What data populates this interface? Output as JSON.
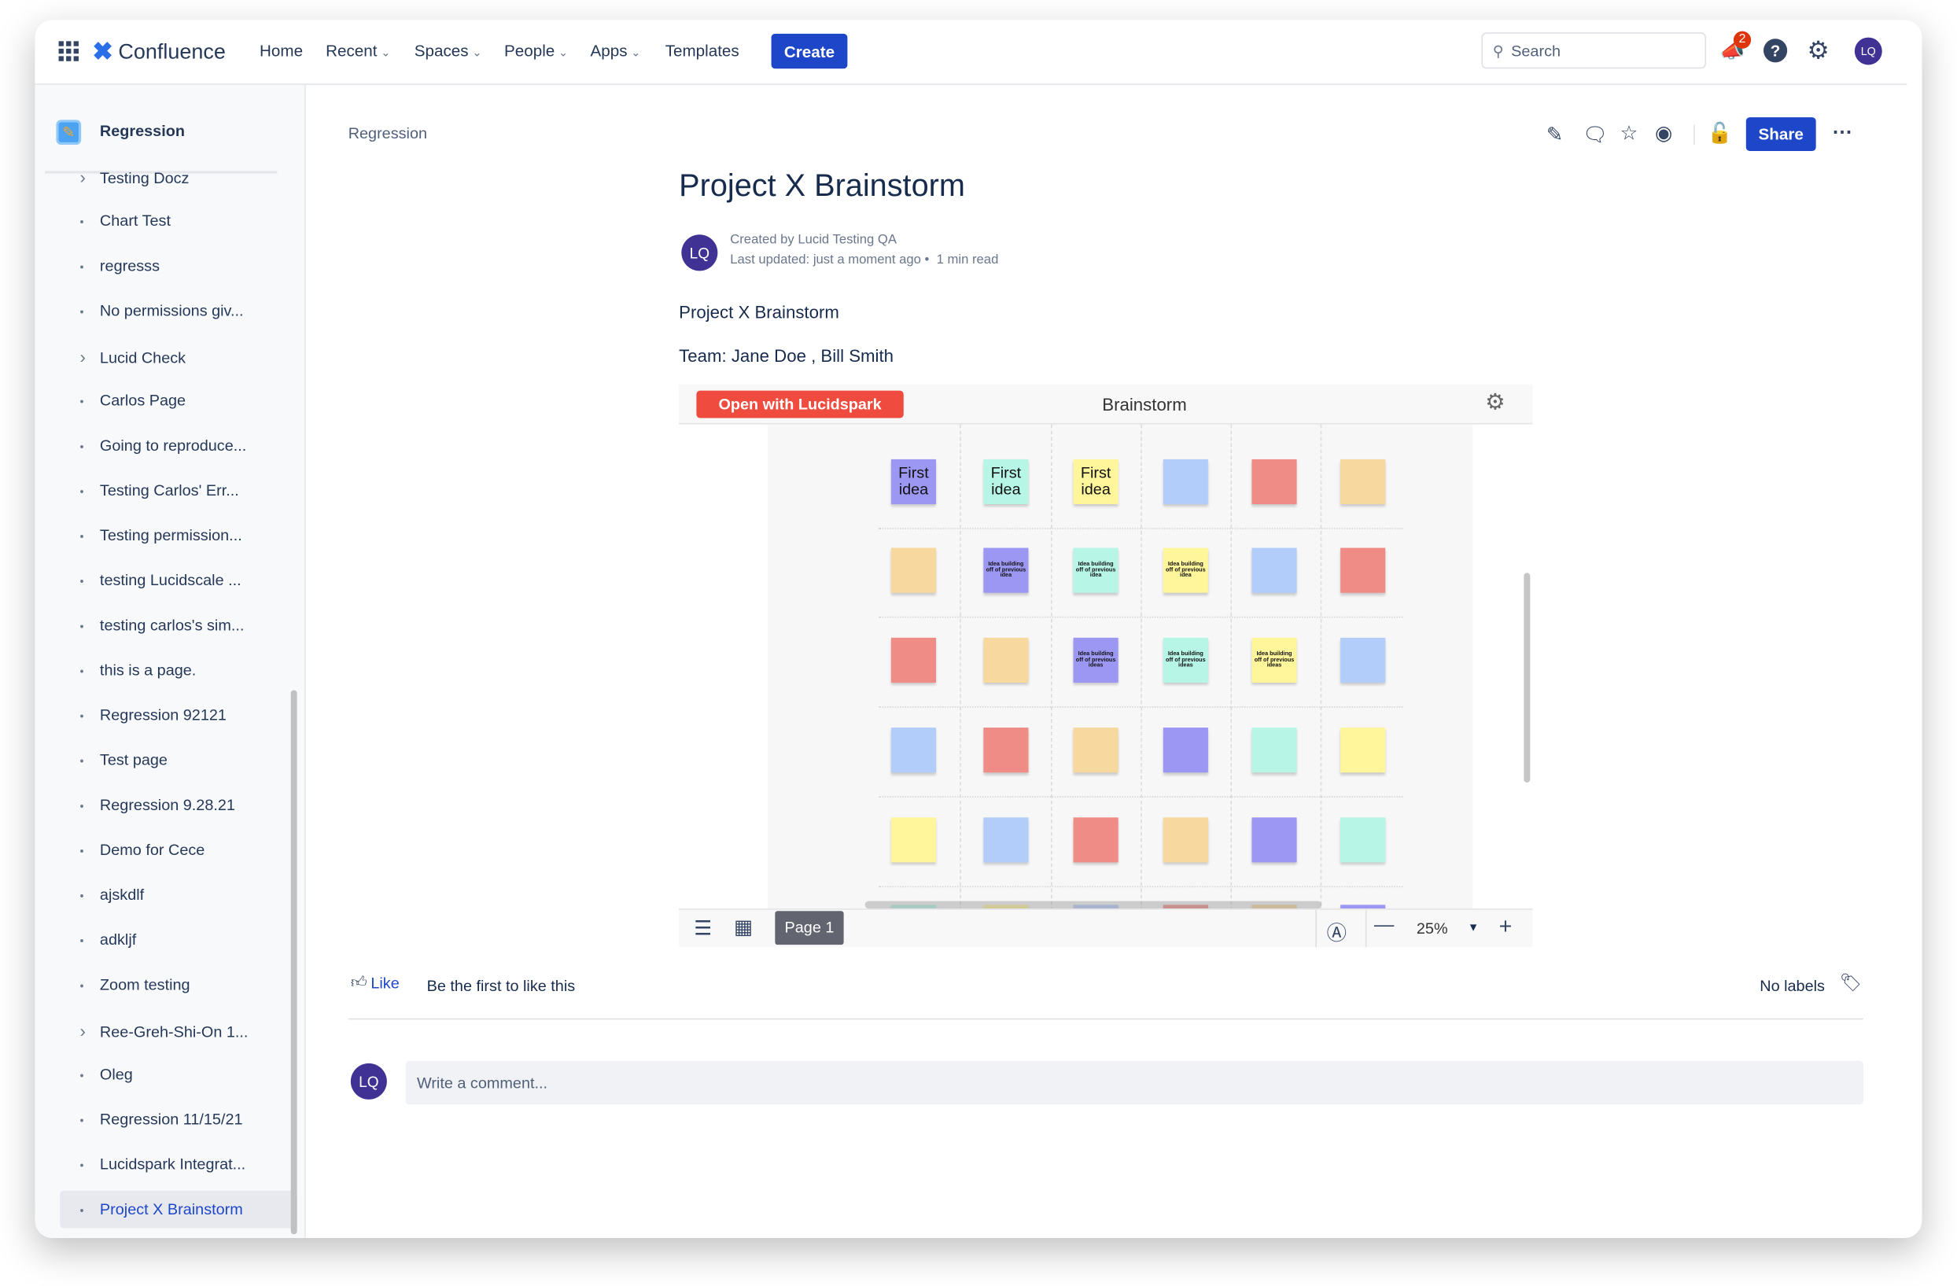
{
  "topbar": {
    "product": "Confluence",
    "nav": [
      {
        "label": "Home",
        "dropdown": false
      },
      {
        "label": "Recent",
        "dropdown": true
      },
      {
        "label": "Spaces",
        "dropdown": true
      },
      {
        "label": "People",
        "dropdown": true
      },
      {
        "label": "Apps",
        "dropdown": true
      },
      {
        "label": "Templates",
        "dropdown": false
      }
    ],
    "create_label": "Create",
    "search_placeholder": "Search",
    "notification_count": "2",
    "user_initials": "LQ",
    "accent": "#1d47c8"
  },
  "sidebar": {
    "space_name": "Regression",
    "items": [
      {
        "label": "Testing Docz",
        "expandable": true
      },
      {
        "label": "Chart Test",
        "expandable": false
      },
      {
        "label": "regresss",
        "expandable": false
      },
      {
        "label": "No permissions giv...",
        "expandable": false
      },
      {
        "label": "Lucid Check",
        "expandable": true
      },
      {
        "label": "Carlos Page",
        "expandable": false
      },
      {
        "label": "Going to reproduce...",
        "expandable": false
      },
      {
        "label": "Testing Carlos' Err...",
        "expandable": false
      },
      {
        "label": "Testing permission...",
        "expandable": false
      },
      {
        "label": "testing Lucidscale ...",
        "expandable": false
      },
      {
        "label": "testing carlos's sim...",
        "expandable": false
      },
      {
        "label": "this is a page.",
        "expandable": false
      },
      {
        "label": "Regression 92121",
        "expandable": false
      },
      {
        "label": "Test page",
        "expandable": false
      },
      {
        "label": "Regression 9.28.21",
        "expandable": false
      },
      {
        "label": "Demo for Cece",
        "expandable": false
      },
      {
        "label": "ajskdlf",
        "expandable": false
      },
      {
        "label": "adkljf",
        "expandable": false
      },
      {
        "label": "Zoom testing",
        "expandable": false
      },
      {
        "label": "Ree-Greh-Shi-On 1...",
        "expandable": true
      },
      {
        "label": "Oleg",
        "expandable": false
      },
      {
        "label": "Regression 11/15/21",
        "expandable": false
      },
      {
        "label": "Lucidspark Integrat...",
        "expandable": false
      },
      {
        "label": "Project X Brainstorm",
        "expandable": false,
        "active": true
      }
    ]
  },
  "page": {
    "breadcrumb": "Regression",
    "share_label": "Share",
    "title": "Project X Brainstorm",
    "author_initials": "LQ",
    "created_by": "Created by Lucid Testing QA",
    "last_updated": "Last updated: just a moment ago",
    "read_time": "1 min read",
    "body_line1": "Project X Brainstorm",
    "body_line2": "Team: Jane Doe , Bill Smith"
  },
  "embed": {
    "open_button": "Open with Lucidspark",
    "open_button_color": "#ef4b3f",
    "title": "Brainstorm",
    "page_tab": "Page 1",
    "zoom": "25%",
    "colors": {
      "purple": "#9d97f4",
      "teal": "#b7f5e6",
      "yellow": "#fff59b",
      "blue": "#b3cdfb",
      "red": "#f08c86",
      "orange": "#f7d89e"
    },
    "grid": [
      [
        {
          "c": "purple",
          "t": "First idea"
        },
        {
          "c": "teal",
          "t": "First idea"
        },
        {
          "c": "yellow",
          "t": "First idea"
        },
        {
          "c": "blue"
        },
        {
          "c": "red"
        },
        {
          "c": "orange"
        }
      ],
      [
        {
          "c": "orange"
        },
        {
          "c": "purple",
          "s": "Idea building off of previous idea"
        },
        {
          "c": "teal",
          "s": "Idea building off of previous idea"
        },
        {
          "c": "yellow",
          "s": "Idea building off of previous idea"
        },
        {
          "c": "blue"
        },
        {
          "c": "red"
        }
      ],
      [
        {
          "c": "red"
        },
        {
          "c": "orange"
        },
        {
          "c": "purple",
          "s": "Idea building off of previous ideas"
        },
        {
          "c": "teal",
          "s": "Idea building off of previous ideas"
        },
        {
          "c": "yellow",
          "s": "Idea building off of previous ideas"
        },
        {
          "c": "blue"
        }
      ],
      [
        {
          "c": "blue"
        },
        {
          "c": "red"
        },
        {
          "c": "orange"
        },
        {
          "c": "purple"
        },
        {
          "c": "teal"
        },
        {
          "c": "yellow"
        }
      ],
      [
        {
          "c": "yellow"
        },
        {
          "c": "blue"
        },
        {
          "c": "red"
        },
        {
          "c": "orange"
        },
        {
          "c": "purple"
        },
        {
          "c": "teal"
        }
      ],
      [
        {
          "c": "teal"
        },
        {
          "c": "yellow"
        },
        {
          "c": "blue"
        },
        {
          "c": "red"
        },
        {
          "c": "orange"
        },
        {
          "c": "purple"
        }
      ]
    ]
  },
  "footer": {
    "like_label": "Like",
    "like_text": "Be the first to like this",
    "labels_text": "No labels",
    "comment_placeholder": "Write a comment..."
  }
}
